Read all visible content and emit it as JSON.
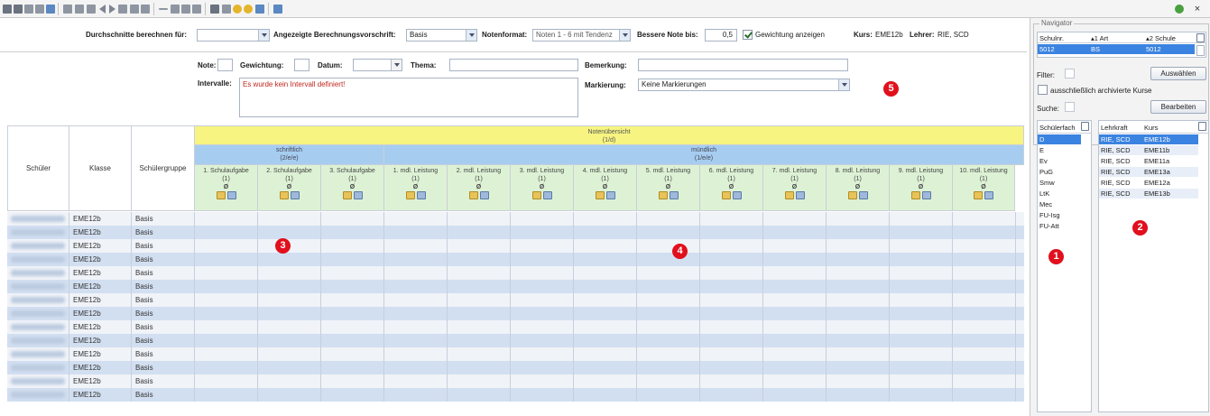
{
  "settings": {
    "avg_for_label": "Durchschnitte berechnen für:",
    "avg_for_value": "",
    "calc_rule_label": "Angezeigte Berechnungsvorschrift:",
    "calc_rule_value": "Basis",
    "format_label": "Notenformat:",
    "format_value": "Noten 1 - 6 mit Tendenz",
    "better_grade_label": "Bessere Note bis:",
    "better_grade_value": "0,5",
    "show_weight_label": "Gewichtung anzeigen",
    "show_weight_checked": true,
    "kurs_label": "Kurs:",
    "kurs_value": "EME12b",
    "teacher_label": "Lehrer:",
    "teacher_value": "RIE, SCD"
  },
  "entry": {
    "note_label": "Note:",
    "note_value": "",
    "weight_label": "Gewichtung:",
    "weight_value": "",
    "date_label": "Datum:",
    "date_value": "",
    "topic_label": "Thema:",
    "topic_value": "",
    "remark_label": "Bemerkung:",
    "remark_value": "",
    "interval_label": "Intervalle:",
    "interval_text": "Es wurde kein Intervall definiert!",
    "marking_label": "Markierung:",
    "marking_value": "Keine Markierungen"
  },
  "grid": {
    "col_student": "Schüler",
    "col_class": "Klasse",
    "col_group": "Schülergruppe",
    "overview_title": "Notenübersicht",
    "overview_sub": "(1/d)",
    "written_title": "schriftlich",
    "written_sub": "(2/e/e)",
    "oral_title": "mündlich",
    "oral_sub": "(1/e/e)",
    "assessments": [
      "1. Schulaufgabe",
      "2. Schulaufgabe",
      "3. Schulaufgabe",
      "1. mdl. Leistung",
      "2. mdl. Leistung",
      "3. mdl. Leistung",
      "4. mdl. Leistung",
      "5. mdl. Leistung",
      "6. mdl. Leistung",
      "7. mdl. Leistung",
      "8. mdl. Leistung",
      "9. mdl. Leistung",
      "10. mdl. Leistung"
    ],
    "assessment_weight": "(1)",
    "assessment_avg": "Ø",
    "rows": [
      {
        "klasse": "EME12b",
        "gruppe": "Basis"
      },
      {
        "klasse": "EME12b",
        "gruppe": "Basis"
      },
      {
        "klasse": "EME12b",
        "gruppe": "Basis"
      },
      {
        "klasse": "EME12b",
        "gruppe": "Basis"
      },
      {
        "klasse": "EME12b",
        "gruppe": "Basis"
      },
      {
        "klasse": "EME12b",
        "gruppe": "Basis"
      },
      {
        "klasse": "EME12b",
        "gruppe": "Basis"
      },
      {
        "klasse": "EME12b",
        "gruppe": "Basis"
      },
      {
        "klasse": "EME12b",
        "gruppe": "Basis"
      },
      {
        "klasse": "EME12b",
        "gruppe": "Basis"
      },
      {
        "klasse": "EME12b",
        "gruppe": "Basis"
      },
      {
        "klasse": "EME12b",
        "gruppe": "Basis"
      },
      {
        "klasse": "EME12b",
        "gruppe": "Basis"
      },
      {
        "klasse": "EME12b",
        "gruppe": "Basis"
      }
    ]
  },
  "markers": [
    "1",
    "2",
    "3",
    "4",
    "5"
  ],
  "navigator": {
    "title": "Navigator",
    "schools_headers": [
      "Schulnr.",
      "Art",
      "Schule"
    ],
    "schools_rows": [
      [
        "5012",
        "BS",
        "5012"
      ]
    ],
    "filter_label": "Filter:",
    "select_button": "Auswählen",
    "archived_label": "ausschließlich archivierte Kurse",
    "search_label": "Suche:",
    "edit_button": "Bearbeiten",
    "subjects_header": "Schülerfach",
    "subjects": [
      "D",
      "E",
      "Ev",
      "PuG",
      "Smw",
      "LtK",
      "Mec",
      "FU-Isg",
      "FU-Att"
    ],
    "courses_headers": [
      "Lehrkraft",
      "Kurs"
    ],
    "courses": [
      [
        "RIE, SCD",
        "EME12b"
      ],
      [
        "RIE, SCD",
        "EME11b"
      ],
      [
        "RIE, SCD",
        "EME11a"
      ],
      [
        "RIE, SCD",
        "EME13a"
      ],
      [
        "RIE, SCD",
        "EME12a"
      ],
      [
        "RIE, SCD",
        "EME13b"
      ]
    ]
  },
  "colors": {
    "overview": "#f7f482",
    "group_header": "#a6cdf0",
    "assessment_header": "#ddf2d5",
    "row_alt": "#d2dff1",
    "marker": "#e0101c",
    "selection": "#3b83e0"
  }
}
